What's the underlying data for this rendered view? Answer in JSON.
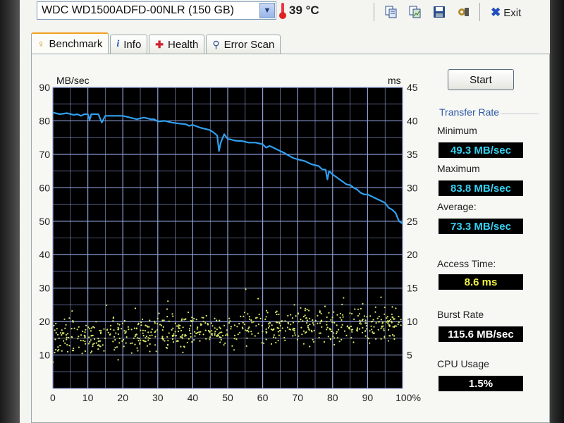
{
  "toolbar": {
    "drive": "WDC WD1500ADFD-00NLR (150 GB)",
    "temperature": "39 °C",
    "exit_label": "Exit",
    "icons": [
      "copy-text-icon",
      "copy-image-icon",
      "save-icon",
      "options-icon"
    ]
  },
  "tabs": [
    {
      "label": "Benchmark",
      "icon": "benchmark-icon",
      "active": true
    },
    {
      "label": "Info",
      "icon": "info-icon",
      "active": false
    },
    {
      "label": "Health",
      "icon": "health-icon",
      "active": false
    },
    {
      "label": "Error Scan",
      "icon": "search-icon",
      "active": false
    }
  ],
  "benchmark": {
    "start_label": "Start",
    "transfer_rate_title": "Transfer Rate",
    "minimum_label": "Minimum",
    "minimum_value": "49.3 MB/sec",
    "maximum_label": "Maximum",
    "maximum_value": "83.8 MB/sec",
    "average_label": "Average:",
    "average_value": "73.3 MB/sec",
    "access_time_label": "Access Time:",
    "access_time_value": "8.6 ms",
    "burst_rate_label": "Burst Rate",
    "burst_rate_value": "115.6 MB/sec",
    "cpu_usage_label": "CPU Usage",
    "cpu_usage_value": "1.5%"
  },
  "colors": {
    "plot_bg": "#000000",
    "grid": "#8fa0d8",
    "transfer_line": "#2fa0f0",
    "access_dots": "#d8e86a",
    "value_cyan": "#34d0f0",
    "value_yellow": "#f0ee40",
    "value_white": "#ffffff"
  },
  "chart_data": {
    "type": "line",
    "ylabel": "MB/sec",
    "y2label": "ms",
    "ylim": [
      0,
      90
    ],
    "y2lim": [
      0,
      45
    ],
    "xlim": [
      0,
      100
    ],
    "x_ticks": [
      "0",
      "10",
      "20",
      "30",
      "40",
      "50",
      "60",
      "70",
      "80",
      "90",
      "100%"
    ],
    "y_ticks": [
      "10",
      "20",
      "30",
      "40",
      "50",
      "60",
      "70",
      "80",
      "90"
    ],
    "y2_ticks": [
      "5",
      "10",
      "15",
      "20",
      "25",
      "30",
      "35",
      "40",
      "45"
    ],
    "grid": true,
    "series": [
      {
        "type": "line",
        "x": [
          0,
          2,
          4,
          6,
          7,
          8,
          9,
          10,
          10.5,
          11,
          12,
          13,
          14,
          15,
          16,
          18,
          20,
          22,
          24,
          26,
          28,
          29,
          30,
          32,
          34,
          36,
          38,
          39,
          40,
          42,
          44,
          45,
          46,
          47,
          47.5,
          48,
          49,
          50,
          51,
          52,
          53,
          54,
          56,
          58,
          60,
          61,
          62,
          63,
          64,
          66,
          68,
          69,
          70,
          72,
          74,
          76,
          77,
          78,
          78.5,
          79,
          80,
          82,
          84,
          85,
          86,
          87,
          88,
          89,
          90,
          92,
          94,
          95,
          96,
          97,
          98,
          99,
          100
        ],
        "y": [
          82.5,
          82,
          82.3,
          81.8,
          82,
          81.5,
          82,
          82,
          80.3,
          82,
          82,
          82,
          79.5,
          81.5,
          81.5,
          81.5,
          81.5,
          81,
          80.5,
          81,
          80.5,
          80.5,
          79.8,
          80,
          79.5,
          79.2,
          79,
          78.5,
          78.8,
          78,
          77.5,
          77.2,
          76.5,
          75.6,
          71,
          73.5,
          76,
          74.6,
          74.4,
          74.1,
          74,
          74,
          73.5,
          73.5,
          73,
          72,
          72.5,
          72,
          71.5,
          70.5,
          69.3,
          68.8,
          68.5,
          68,
          67,
          66.5,
          65.5,
          65.4,
          62.5,
          65,
          64,
          62.5,
          61,
          60.8,
          60,
          59.5,
          58.5,
          58,
          58,
          57,
          56,
          55.5,
          54,
          53.5,
          52.5,
          50,
          49.3
        ]
      },
      {
        "type": "scatter",
        "axis": "ms",
        "approx_range_ms": [
          3,
          16
        ],
        "approx_mean_ms": 8.6
      }
    ]
  }
}
